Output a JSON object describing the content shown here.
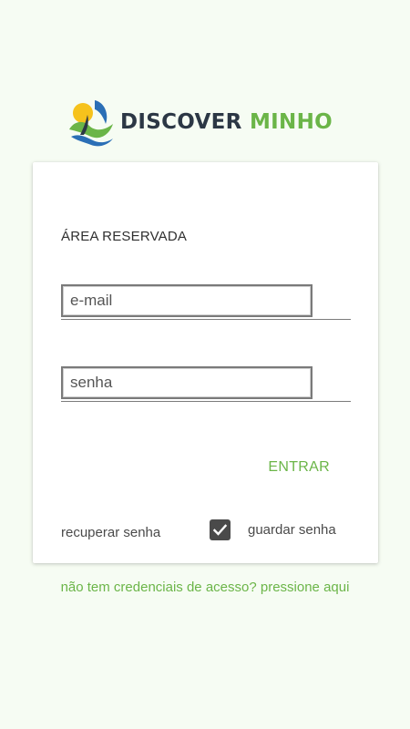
{
  "logo": {
    "word1": "DISCOVER",
    "word2": "MINHO",
    "icon": "discover-minho-logo-icon",
    "colors": {
      "dark": "#2c3745",
      "green": "#6bb548",
      "yellow": "#f6c21c",
      "blue": "#2b6fb6"
    }
  },
  "card": {
    "title": "ÁREA RESERVADA",
    "email": {
      "placeholder": "e-mail",
      "value": ""
    },
    "password": {
      "placeholder": "senha",
      "value": ""
    },
    "enter_label": "ENTRAR",
    "recover_label": "recuperar senha",
    "remember_label": "guardar senha",
    "remember_checked": true
  },
  "footer": {
    "register_text": "não tem credenciais de acesso? pressione aqui"
  },
  "theme": {
    "background": "#f6fcf3",
    "accent": "#6bb548"
  }
}
